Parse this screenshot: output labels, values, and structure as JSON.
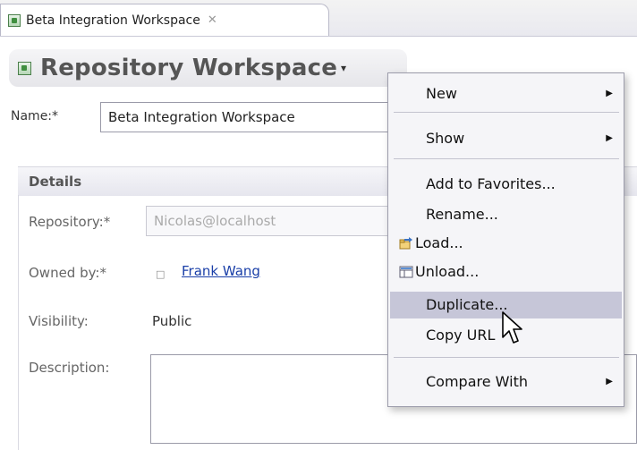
{
  "tab": {
    "title": "Beta Integration Workspace",
    "close_glyph": "✕"
  },
  "header": {
    "title": "Repository Workspace",
    "caret": "▾"
  },
  "name_field": {
    "label": "Name:*",
    "value": "Beta Integration Workspace"
  },
  "details": {
    "section_title": "Details",
    "repository": {
      "label": "Repository:*",
      "value": "Nicolas@localhost"
    },
    "owned_by": {
      "label": "Owned by:*",
      "value": "Frank Wang"
    },
    "visibility": {
      "label": "Visibility:",
      "value": "Public"
    },
    "description": {
      "label": "Description:",
      "value": ""
    }
  },
  "context_menu": {
    "items": [
      {
        "label": "New",
        "submenu": true
      },
      {
        "label": "Show",
        "submenu": true
      },
      {
        "label": "Add to Favorites..."
      },
      {
        "label": "Rename..."
      },
      {
        "label": "Load...",
        "icon": "load-icon"
      },
      {
        "label": "Unload...",
        "icon": "unload-icon"
      },
      {
        "label": "Duplicate...",
        "highlighted": true
      },
      {
        "label": "Copy URL"
      },
      {
        "label": "Compare With",
        "submenu": true
      }
    ],
    "submenu_arrow": "▶"
  },
  "colors": {
    "link": "#1a3fa8",
    "menu_highlight": "#c6c6d8",
    "workspace_icon": "#3f8f3f"
  }
}
